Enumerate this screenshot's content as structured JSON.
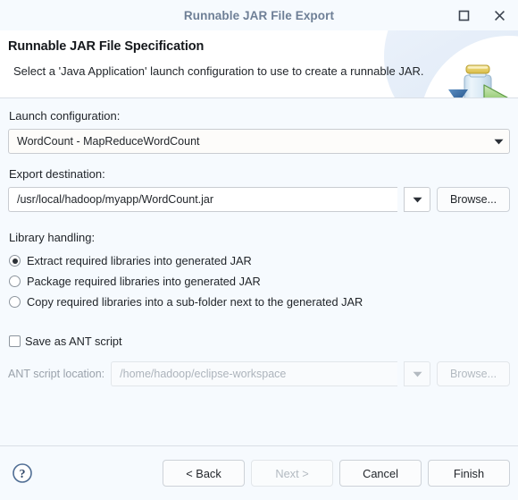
{
  "window": {
    "title": "Runnable JAR File Export",
    "controls": [
      {
        "name": "maximize-button",
        "glyph": "maximize-icon"
      },
      {
        "name": "close-button",
        "glyph": "close-icon"
      }
    ]
  },
  "header": {
    "title": "Runnable JAR File Specification",
    "description": "Select a 'Java Application' launch configuration to use to create a runnable JAR.",
    "icon": "jar-export-icon"
  },
  "form": {
    "launch_configuration": {
      "label": "Launch configuration:",
      "value": "WordCount - MapReduceWordCount"
    },
    "export_destination": {
      "label": "Export destination:",
      "value": "/usr/local/hadoop/myapp/WordCount.jar",
      "browse_label": "Browse..."
    },
    "library_handling": {
      "label": "Library handling:",
      "options": [
        {
          "label": "Extract required libraries into generated JAR",
          "selected": true
        },
        {
          "label": "Package required libraries into generated JAR",
          "selected": false
        },
        {
          "label": "Copy required libraries into a sub-folder next to the generated JAR",
          "selected": false
        }
      ]
    },
    "ant_script": {
      "checkbox_label": "Save as ANT script",
      "checked": false,
      "location_label": "ANT script location:",
      "location_value": "/home/hadoop/eclipse-workspace",
      "browse_label": "Browse...",
      "enabled": false
    }
  },
  "footer": {
    "help_icon": "help-icon",
    "buttons": [
      {
        "label": "< Back",
        "name": "back-button",
        "disabled": false
      },
      {
        "label": "Next >",
        "name": "next-button",
        "disabled": true
      },
      {
        "label": "Cancel",
        "name": "cancel-button",
        "disabled": false
      },
      {
        "label": "Finish",
        "name": "finish-button",
        "disabled": false
      }
    ]
  },
  "colors": {
    "dialog_bg": "#f6fafe",
    "header_bg": "#ffffff",
    "title_text": "#6e7f96",
    "border": "#d9dfe6",
    "jar_cap": "#e8d37a",
    "jar_arrow": "#8fc97a",
    "jar_triangle": "#2b5d96"
  }
}
